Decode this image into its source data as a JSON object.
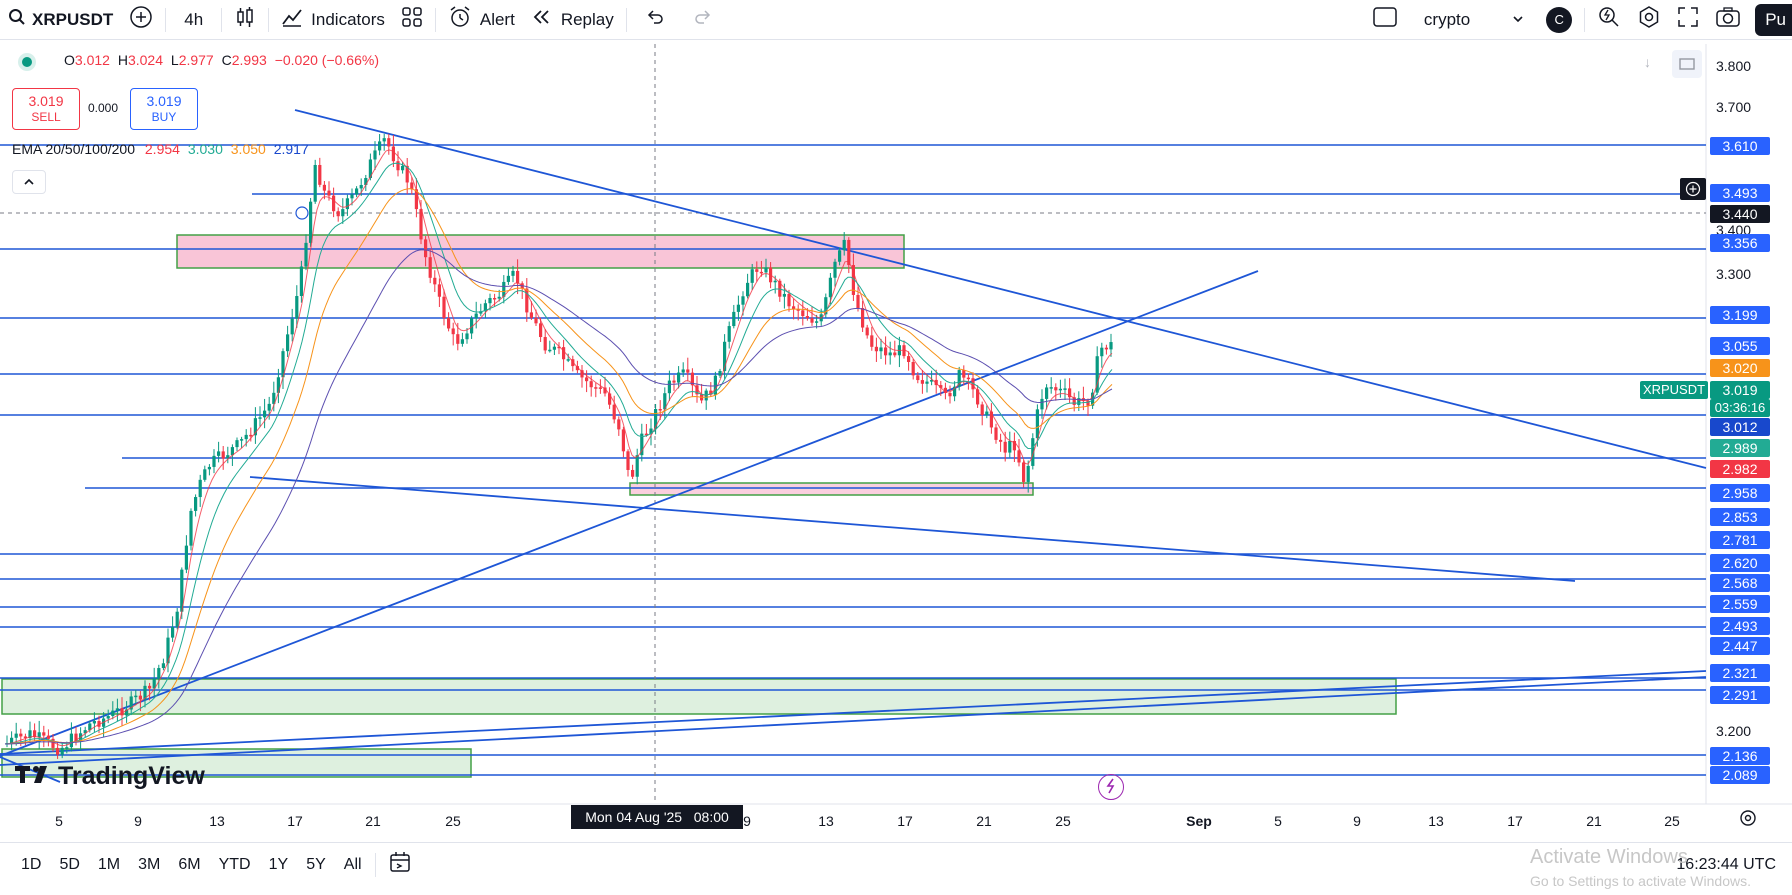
{
  "toolbar": {
    "symbol": "XRPUSDT",
    "interval": "4h",
    "indicators": "Indicators",
    "alert": "Alert",
    "replay": "Replay",
    "watchlist": "crypto",
    "avatar": "C",
    "publish": "Pu"
  },
  "legend": {
    "o_label": "O",
    "o": "3.012",
    "h_label": "H",
    "h": "3.024",
    "l_label": "L",
    "l": "2.977",
    "c_label": "C",
    "c": "2.993",
    "change": "−0.020 (−0.66%)",
    "sell_price": "3.019",
    "sell": "SELL",
    "spread": "0.000",
    "buy_price": "3.019",
    "buy": "BUY",
    "ema_label": "EMA 20/50/100/200",
    "ema20": "2.954",
    "ema50": "3.030",
    "ema100": "3.050",
    "ema200": "2.917"
  },
  "price_axis": {
    "plain": [
      "3.800",
      "3.700",
      "3.400",
      "3.300",
      "3.200"
    ],
    "labels": [
      {
        "v": "3.610",
        "c": "#2962ff"
      },
      {
        "v": "3.493",
        "c": "#2962ff"
      },
      {
        "v": "3.440",
        "c": "#131722"
      },
      {
        "v": "3.356",
        "c": "#2962ff"
      },
      {
        "v": "3.199",
        "c": "#2962ff"
      },
      {
        "v": "3.055",
        "c": "#2962ff"
      },
      {
        "v": "3.020",
        "c": "#f7931a"
      },
      {
        "v": "3.019",
        "c": "#089981"
      },
      {
        "v": "3.012",
        "c": "#1848cc"
      },
      {
        "v": "2.989",
        "c": "#22ab94"
      },
      {
        "v": "2.982",
        "c": "#f23645"
      },
      {
        "v": "2.958",
        "c": "#2962ff"
      },
      {
        "v": "2.853",
        "c": "#2962ff"
      },
      {
        "v": "2.781",
        "c": "#2962ff"
      },
      {
        "v": "2.620",
        "c": "#2962ff"
      },
      {
        "v": "2.568",
        "c": "#2962ff"
      },
      {
        "v": "2.559",
        "c": "#2962ff"
      },
      {
        "v": "2.493",
        "c": "#2962ff"
      },
      {
        "v": "2.447",
        "c": "#2962ff"
      },
      {
        "v": "2.321",
        "c": "#2962ff"
      },
      {
        "v": "2.291",
        "c": "#2962ff"
      },
      {
        "v": "2.136",
        "c": "#2962ff"
      },
      {
        "v": "2.089",
        "c": "#2962ff"
      }
    ],
    "symbol_tag": "XRPUSDT",
    "countdown": "03:36:16"
  },
  "time_axis": {
    "ticks": [
      "5",
      "9",
      "13",
      "17",
      "21",
      "25",
      "9",
      "13",
      "17",
      "21",
      "25",
      "Sep",
      "5",
      "9",
      "13",
      "17",
      "21",
      "25"
    ],
    "crosshair_label": "Mon 04 Aug '25   08:00"
  },
  "bottombar": {
    "ranges": [
      "1D",
      "5D",
      "1M",
      "3M",
      "6M",
      "YTD",
      "1Y",
      "5Y",
      "All"
    ],
    "clock": "16:23:44 UTC"
  },
  "watermark": {
    "brand": "TradingView",
    "activate_title": "Activate Windows",
    "activate_sub": "Go to Settings to activate Windows."
  },
  "colors": {
    "up": "#089981",
    "down": "#f23645",
    "lines": "#1e56d6",
    "ema20": "#f23645",
    "ema50": "#22ab94",
    "ema100": "#f7931a",
    "ema200": "#5c4fb0"
  }
}
